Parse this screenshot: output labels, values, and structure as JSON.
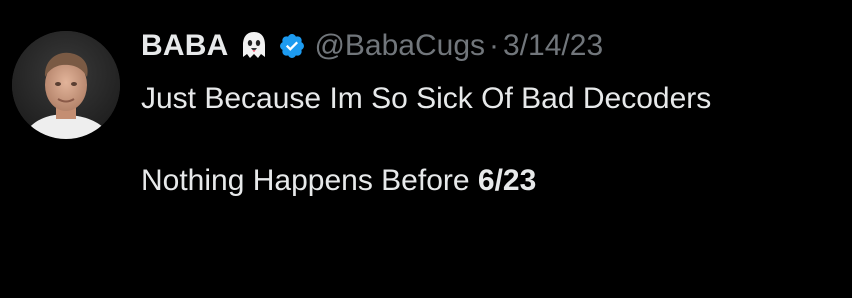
{
  "tweet": {
    "display_name": "BABA",
    "name_emoji": "ghost-emoji",
    "verified_icon": "verified-badge-icon",
    "handle": "@BabaCugs",
    "separator": "·",
    "date": "3/14/23",
    "text_line1": "Just Because Im So Sick Of Bad Decoders",
    "text_line2_prefix": "Nothing Happens Before ",
    "text_line2_bold": "6/23"
  },
  "colors": {
    "background": "#000000",
    "primary_text": "#e7e9ea",
    "secondary_text": "#71767b",
    "verified_blue": "#1d9bf0"
  }
}
